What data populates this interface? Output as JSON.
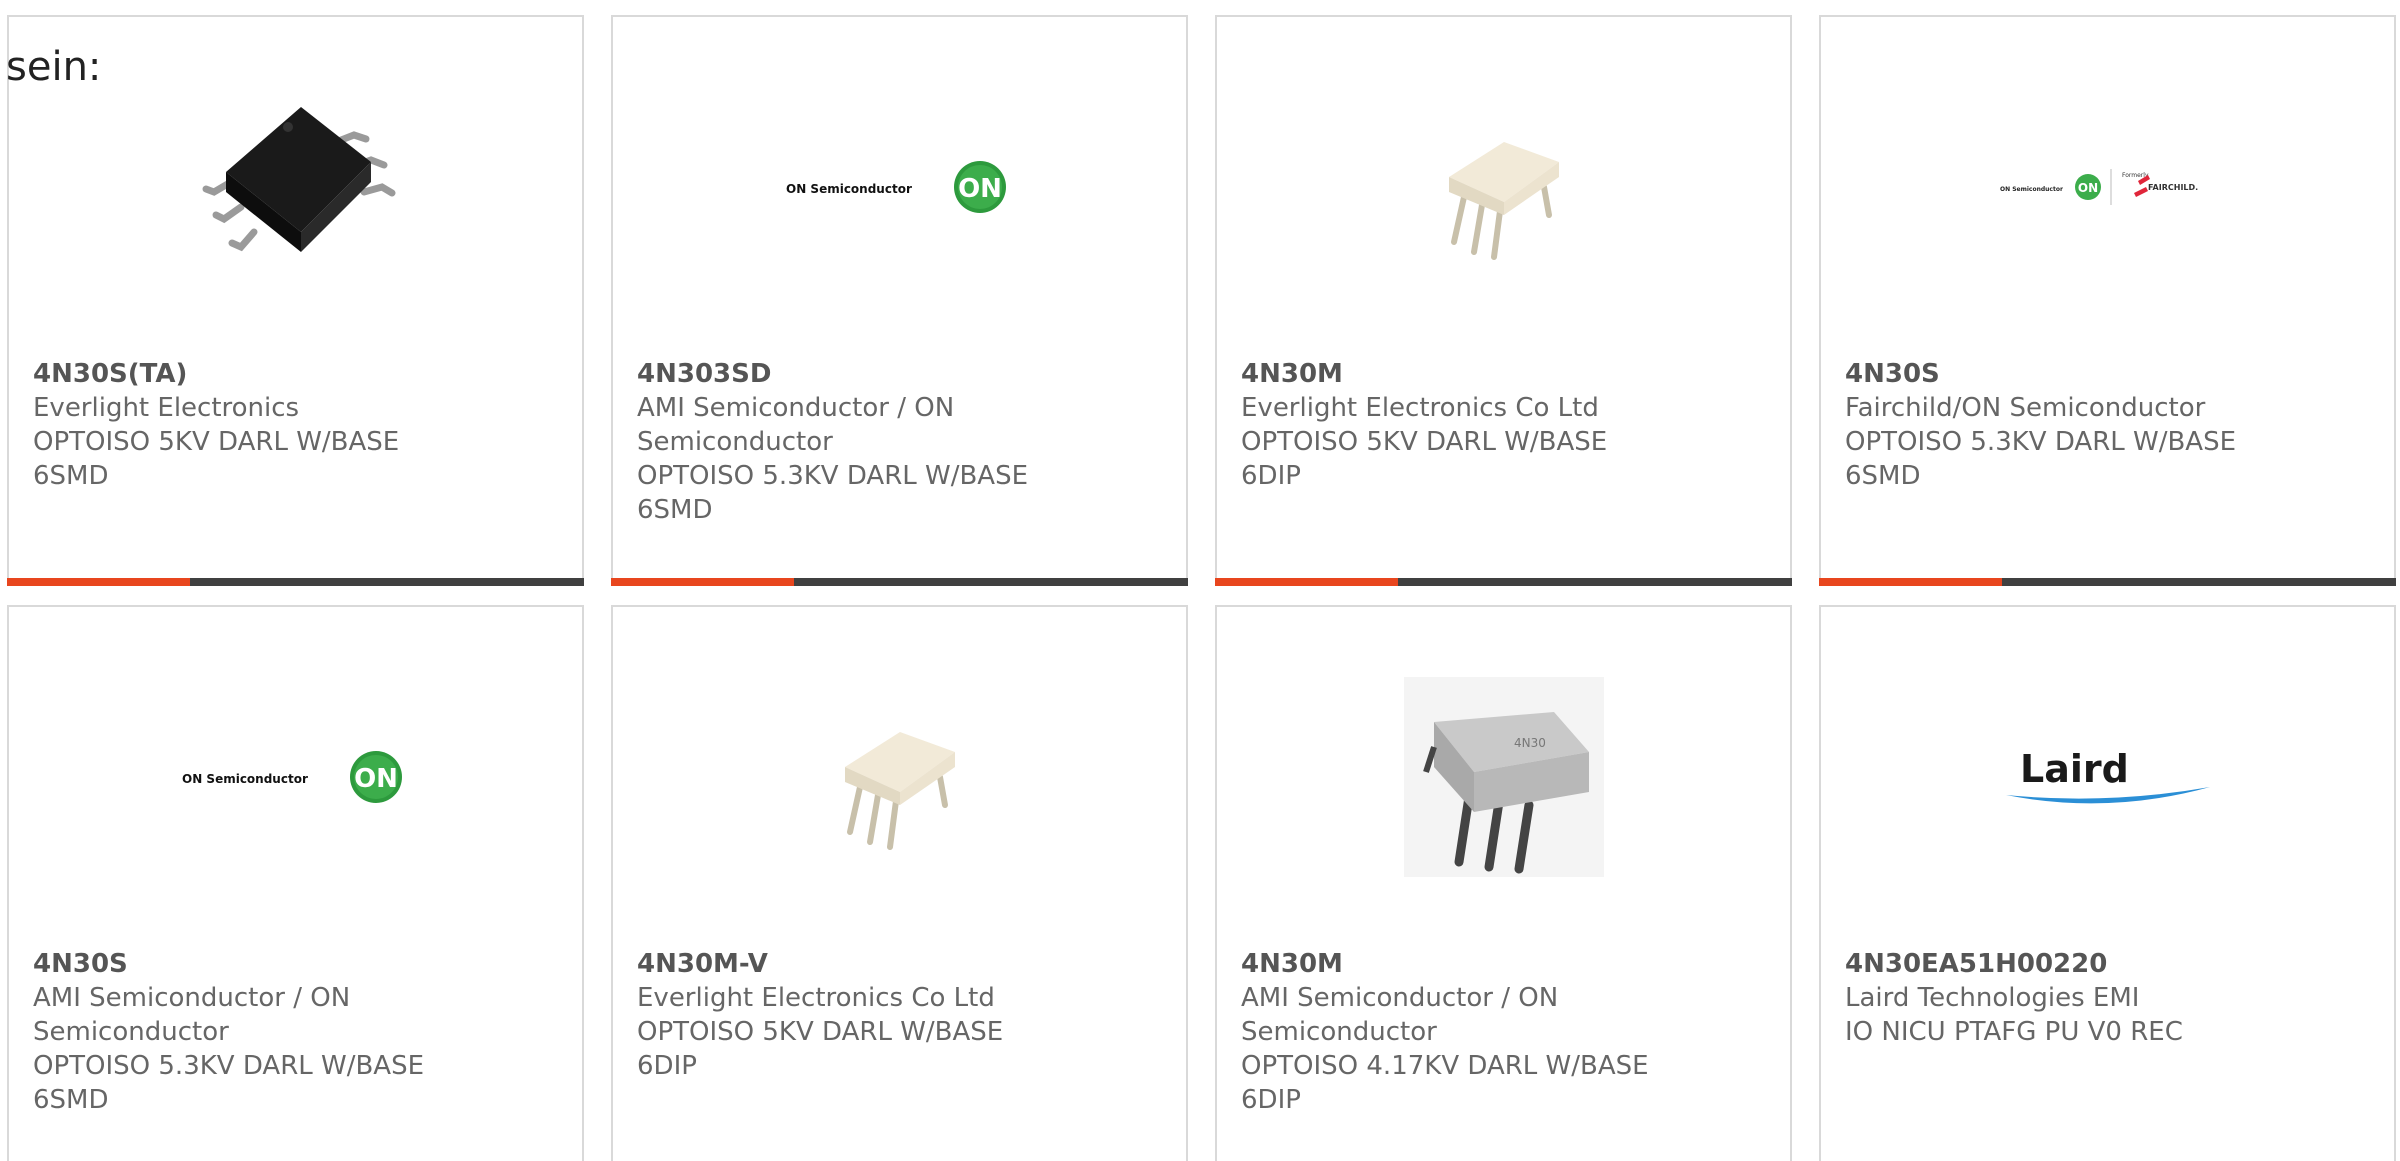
{
  "intro_text": "sein:",
  "colors": {
    "accent": "#e8461e",
    "bar": "#404040",
    "border": "#d9d9d9",
    "text": "#666666"
  },
  "products": [
    {
      "part": "4N30S(TA)",
      "manufacturer": "Everlight Electronics",
      "desc_line1": "OPTOISO 5KV DARL W/BASE",
      "desc_line2": "6SMD",
      "image": "smd-chip-black-icon"
    },
    {
      "part": "4N303SD",
      "manufacturer": "AMI Semiconductor / ON Semiconductor",
      "desc_line1": "OPTOISO 5.3KV DARL W/BASE",
      "desc_line2": "6SMD",
      "image": "on-semiconductor-logo",
      "logo_text": "ON Semiconductor",
      "logo_badge": "ON"
    },
    {
      "part": "4N30M",
      "manufacturer": "Everlight Electronics Co Ltd",
      "desc_line1": "OPTOISO 5KV DARL W/BASE",
      "desc_line2": "6DIP",
      "image": "dip-chip-white-icon"
    },
    {
      "part": "4N30S",
      "manufacturer": "Fairchild/ON Semiconductor",
      "desc_line1": "OPTOISO 5.3KV DARL W/BASE",
      "desc_line2": "6SMD",
      "image": "on-fairchild-logo",
      "logo_text": "ON Semiconductor",
      "logo_badge": "ON",
      "logo_formerly": "Formerly",
      "logo_fairchild": "FAIRCHILD."
    },
    {
      "part": "4N30S",
      "manufacturer": "AMI Semiconductor / ON Semiconductor",
      "desc_line1": "OPTOISO 5.3KV DARL W/BASE",
      "desc_line2": "6SMD",
      "image": "on-semiconductor-logo",
      "logo_text": "ON Semiconductor",
      "logo_badge": "ON"
    },
    {
      "part": "4N30M-V",
      "manufacturer": "Everlight Electronics Co Ltd",
      "desc_line1": "OPTOISO 5KV DARL W/BASE",
      "desc_line2": "6DIP",
      "image": "dip-chip-white-icon"
    },
    {
      "part": "4N30M",
      "manufacturer": "AMI Semiconductor / ON Semiconductor",
      "desc_line1": "OPTOISO 4.17KV DARL W/BASE",
      "desc_line2": "6DIP",
      "image": "dip-chip-grey-icon",
      "chip_marking": "4N30"
    },
    {
      "part": "4N30EA51H00220",
      "manufacturer": "Laird Technologies EMI",
      "desc_line1": "IO NICU PTAFG PU V0 REC",
      "desc_line2": "",
      "image": "laird-logo",
      "logo_text": "Laird"
    }
  ]
}
